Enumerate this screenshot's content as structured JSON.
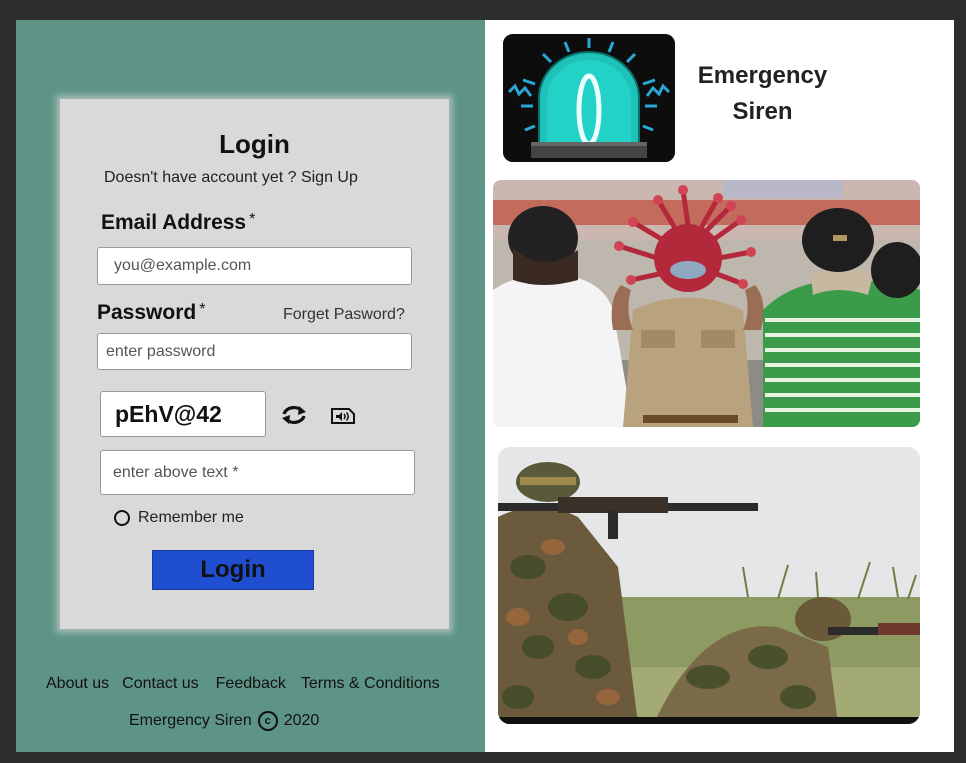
{
  "login": {
    "title": "Login",
    "signup_text": "Doesn't have account yet ? Sign Up",
    "email_label": "Email Address",
    "email_required": "*",
    "email_placeholder": "you@example.com",
    "password_label": "Password",
    "password_required": "*",
    "forget_link": "Forget Pasword?",
    "password_placeholder": "enter password",
    "captcha_text": "pEhV@42",
    "captcha_placeholder": "enter above text *",
    "remember_label": "Remember me",
    "login_button": "Login"
  },
  "footer": {
    "links": [
      "About us",
      "Contact us",
      "Feedback",
      "Terms & Conditions"
    ],
    "brand": "Emergency Siren",
    "copyright_symbol": "c",
    "year": "2020"
  },
  "brand": {
    "line1": "Emergency",
    "line2": "Siren"
  },
  "icons": {
    "refresh": "refresh-icon",
    "audio": "audio-captcha-icon",
    "logo": "siren-icon"
  },
  "colors": {
    "left_panel": "#5e9486",
    "card": "#d9d9d9",
    "login_button": "#1f4fd0",
    "siren": "#1fc2b8"
  }
}
